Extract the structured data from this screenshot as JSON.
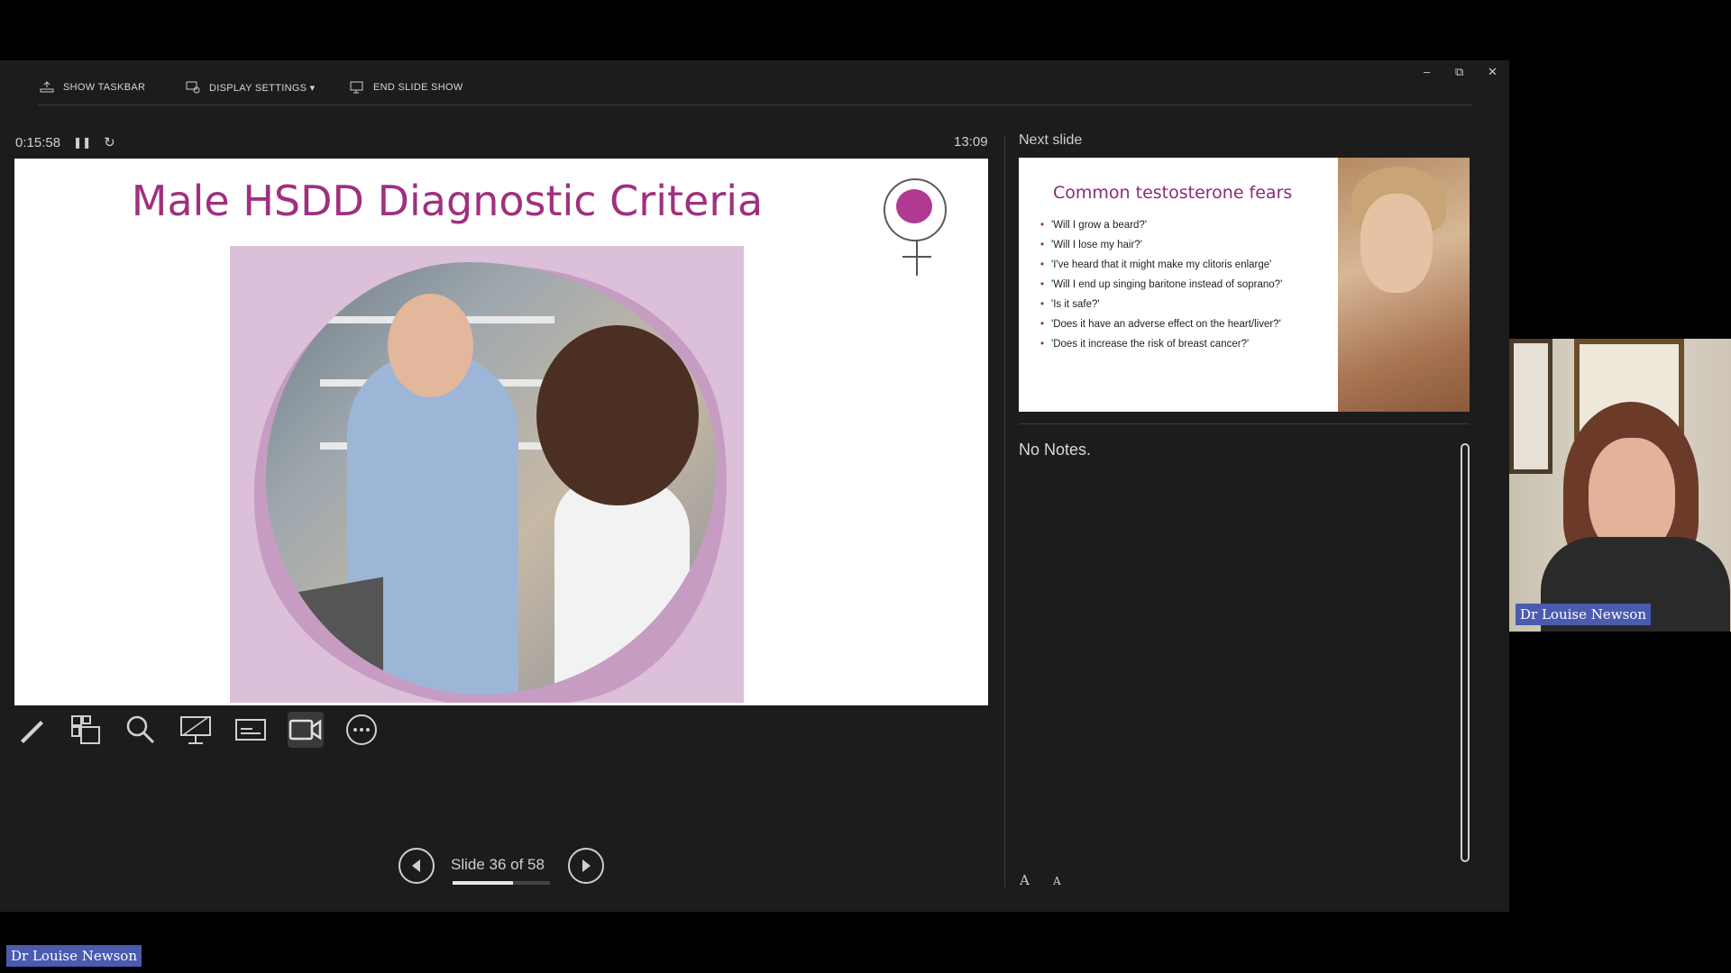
{
  "toolbar": {
    "show_taskbar": "SHOW TASKBAR",
    "display_settings": "DISPLAY SETTINGS ▾",
    "end_slide_show": "END SLIDE SHOW"
  },
  "window_controls": {
    "minimize": "–",
    "restore": "⧉",
    "close": "✕"
  },
  "timer": {
    "elapsed": "0:15:58",
    "pause_icon": "pause-icon",
    "reset_icon": "reset-icon",
    "clock": "13:09"
  },
  "current_slide": {
    "title": "Male HSDD Diagnostic Criteria"
  },
  "tools": [
    {
      "name": "pen-tool-icon"
    },
    {
      "name": "see-all-slides-icon"
    },
    {
      "name": "zoom-icon"
    },
    {
      "name": "black-screen-icon"
    },
    {
      "name": "subtitles-icon"
    },
    {
      "name": "camera-icon"
    },
    {
      "name": "more-options-icon"
    }
  ],
  "navigation": {
    "slide_counter": "Slide 36 of 58",
    "current": 36,
    "total": 58
  },
  "next_slide": {
    "label": "Next slide",
    "title": "Common testosterone fears",
    "bullets": [
      "'Will I grow a beard?'",
      "'Will I lose my hair?'",
      "'I've heard that it might make my clitoris enlarge'",
      "'Will I end up singing baritone instead of soprano?'",
      "'Is it safe?'",
      "'Does it have an adverse effect on the heart/liver?'",
      "'Does it increase the risk of breast cancer?'"
    ]
  },
  "notes": {
    "text": "No Notes.",
    "increase_font": "A",
    "decrease_font": "A"
  },
  "participants": {
    "webcam_name": "Dr Louise Newson",
    "speaker_name": "Dr Louise Newson"
  }
}
